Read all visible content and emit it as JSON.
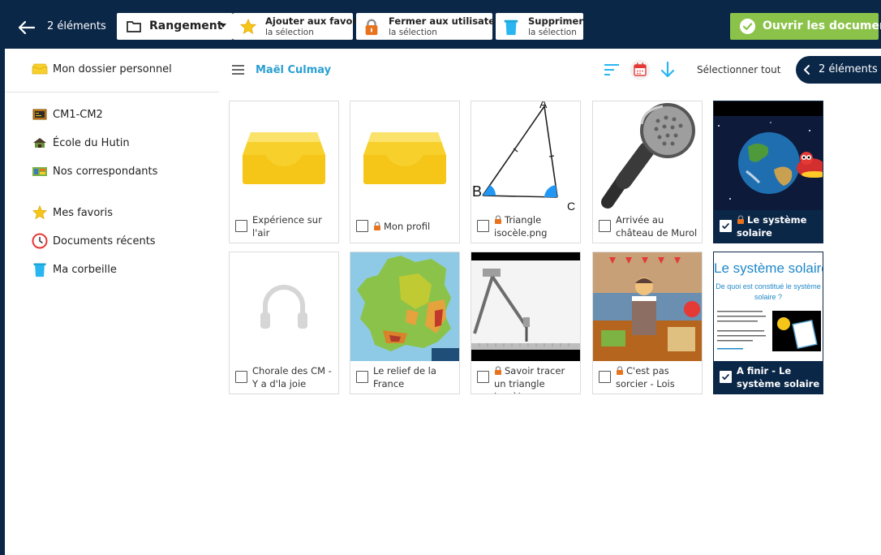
{
  "toolbar": {
    "count": "2 éléments",
    "rangement": "Rangement",
    "favoris_l1": "Ajouter aux favoris",
    "favoris_l2": "la sélection",
    "fermer_l1": "Fermer aux utilisateurs",
    "fermer_l2": "la sélection",
    "supprimer_l1": "Supprimer",
    "supprimer_l2": "la sélection",
    "open": "Ouvrir les documents"
  },
  "sidebar": {
    "items": [
      {
        "label": "Mon dossier personnel",
        "icon": "tray-icon"
      },
      {
        "label": "CM1-CM2",
        "icon": "class-icon"
      },
      {
        "label": "École du Hutin",
        "icon": "school-icon"
      },
      {
        "label": "Nos correspondants",
        "icon": "correspondants-icon"
      },
      {
        "label": "Mes favoris",
        "icon": "star-icon"
      },
      {
        "label": "Documents récents",
        "icon": "clock-icon"
      },
      {
        "label": "Ma corbeille",
        "icon": "trash-icon"
      }
    ]
  },
  "header": {
    "owner": "Maël Culmay",
    "select_all": "Sélectionner tout",
    "count": "2 éléments"
  },
  "documents": [
    {
      "name": "Expérience sur l'air",
      "locked": false,
      "selected": false,
      "thumb": "folder"
    },
    {
      "name": "Mon profil",
      "locked": true,
      "selected": false,
      "thumb": "folder"
    },
    {
      "name": "Triangle isocèle.png",
      "locked": true,
      "selected": false,
      "thumb": "triangle"
    },
    {
      "name": "Arrivée au château de Murol",
      "locked": false,
      "selected": false,
      "thumb": "microphone"
    },
    {
      "name": "Le système solaire",
      "locked": true,
      "selected": true,
      "thumb": "space"
    },
    {
      "name": "Chorale des CM - Y a d'la joie",
      "locked": false,
      "selected": false,
      "thumb": "headphones"
    },
    {
      "name": "Le relief de la France",
      "locked": false,
      "selected": false,
      "thumb": "map"
    },
    {
      "name": "Savoir tracer un triangle isocèle",
      "locked": true,
      "selected": false,
      "thumb": "compass"
    },
    {
      "name": "C'est pas sorcier - Lois",
      "locked": true,
      "selected": false,
      "thumb": "photo"
    },
    {
      "name": "A finir - Le système solaire",
      "locked": false,
      "selected": true,
      "thumb": "slide"
    }
  ],
  "slide_thumb": {
    "title": "Le système solaire",
    "subtitle": "De quoi est constitué le système solaire ?"
  },
  "colors": {
    "navy": "#0b2748",
    "green": "#8bc34a",
    "accent_blue": "#2a9fd0",
    "folder_yellow": "#f7d02c",
    "lock_orange": "#e8731f"
  }
}
